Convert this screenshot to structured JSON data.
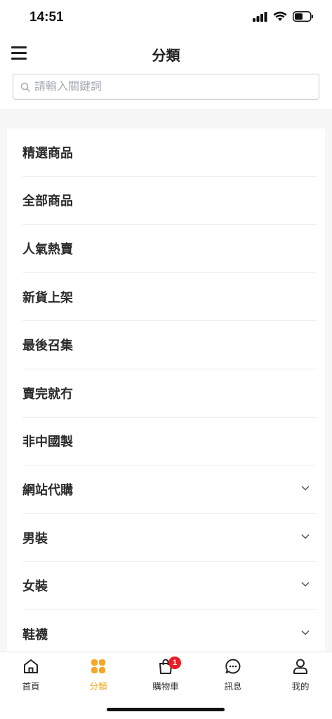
{
  "status_bar": {
    "time": "14:51"
  },
  "header": {
    "title": "分類"
  },
  "search": {
    "placeholder": "請輸入關鍵詞"
  },
  "categories": [
    {
      "label": "精選商品",
      "expandable": false
    },
    {
      "label": "全部商品",
      "expandable": false
    },
    {
      "label": "人氣熱賣",
      "expandable": false
    },
    {
      "label": "新貨上架",
      "expandable": false
    },
    {
      "label": "最後召集",
      "expandable": false
    },
    {
      "label": "賣完就冇",
      "expandable": false
    },
    {
      "label": "非中國製",
      "expandable": false
    },
    {
      "label": "網站代購",
      "expandable": true
    },
    {
      "label": "男裝",
      "expandable": true
    },
    {
      "label": "女裝",
      "expandable": true
    },
    {
      "label": "鞋襪",
      "expandable": true
    }
  ],
  "tabbar": {
    "home": "首頁",
    "category": "分類",
    "cart": "購物車",
    "cart_badge": "1",
    "messages": "訊息",
    "me": "我的"
  },
  "colors": {
    "accent": "#f5a623",
    "badge": "#ee1c25"
  }
}
